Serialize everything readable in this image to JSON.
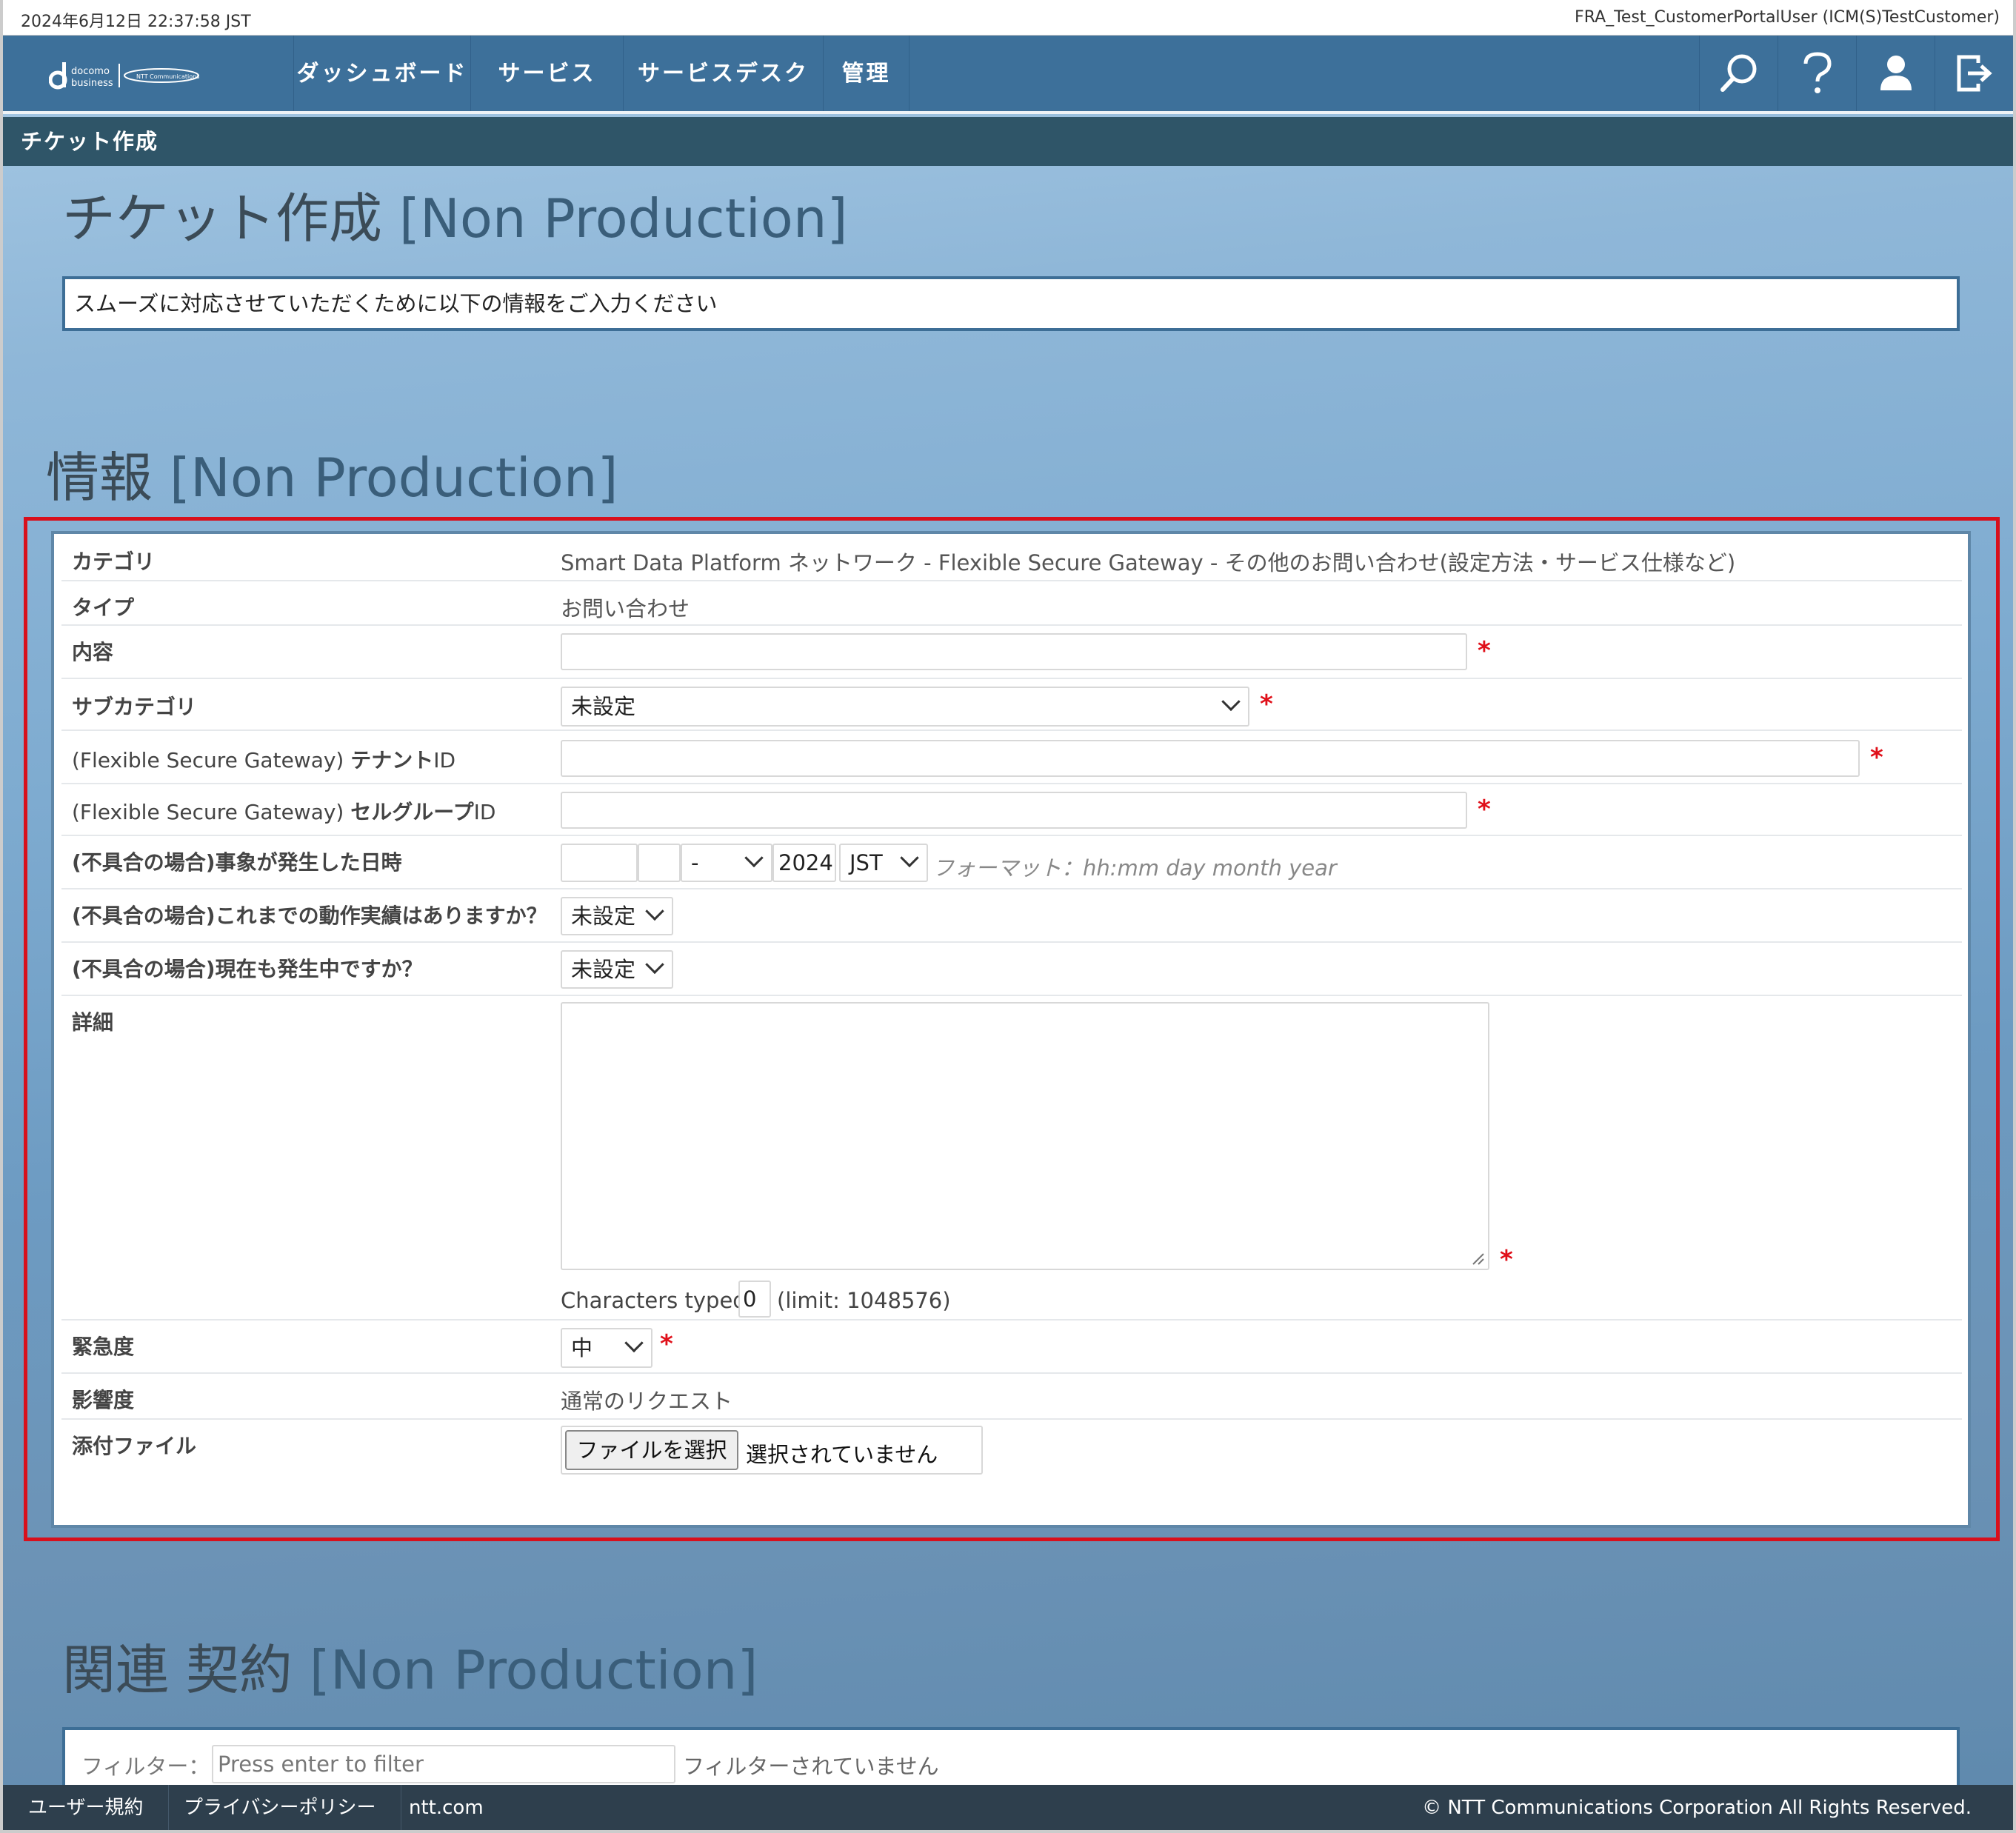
{
  "status_bar": {
    "datetime": "2024年6月12日 22:37:58 JST",
    "user": "FRA_Test_CustomerPortalUser (ICM(S)TestCustomer)"
  },
  "brand": {
    "docomo": "docomo",
    "business": "business",
    "ntt": "NTT Communications"
  },
  "nav": {
    "items": [
      "ダッシュボード",
      "サービス",
      "サービスデスク",
      "管理"
    ],
    "icons": [
      "search-icon",
      "help-icon",
      "user-icon",
      "logout-icon"
    ]
  },
  "breadcrumb": "チケット作成",
  "page": {
    "title": "チケット作成",
    "title_tag": "[Non Production]",
    "notice": "スムーズに対応させていただくために以下の情報をご入力ください"
  },
  "info": {
    "title": "情報",
    "title_tag": "[Non Production]"
  },
  "form": {
    "category_label": "カテゴリ",
    "category_value": "Smart Data Platform ネットワーク - Flexible Secure Gateway - その他のお問い合わせ(設定方法・サービス仕様など)",
    "type_label": "タイプ",
    "type_value": "お問い合わせ",
    "content_label": "内容",
    "subcategory_label": "サブカテゴリ",
    "subcategory_value": "未設定",
    "tenant_label_prefix": "(Flexible Secure Gateway) ",
    "tenant_label": "テナント",
    "tenant_label_suffix": "ID",
    "cellgroup_label_prefix": "(Flexible Secure Gateway) ",
    "cellgroup_label": "セルグループ",
    "cellgroup_label_suffix": "ID",
    "occurred_label": "(不具合の場合)事象が発生した日時",
    "occurred_month": "-",
    "occurred_year": "2024",
    "occurred_tz": "JST",
    "occurred_format": "フォーマット：hh:mm day month year",
    "history_label": "(不具合の場合)これまでの動作実績はありますか？",
    "history_value": "未設定",
    "ongoing_label": "(不具合の場合)現在も発生中ですか？",
    "ongoing_value": "未設定",
    "detail_label": "詳細",
    "chars_typed_label": "Characters typed:",
    "chars_typed_value": "0",
    "chars_limit": "(limit: 1048576)",
    "urgency_label": "緊急度",
    "urgency_value": "中",
    "impact_label": "影響度",
    "impact_value": "通常のリクエスト",
    "attach_label": "添付ファイル",
    "attach_button": "ファイルを選択",
    "attach_status": "選択されていません"
  },
  "contract": {
    "title": "関連 契約",
    "title_tag": "[Non Production]",
    "filter_label": "フィルター：",
    "filter_placeholder": "Press enter to filter",
    "filter_status": "フィルターされていません"
  },
  "footer": {
    "links": [
      "ユーザー規約",
      "プライバシーポリシー",
      "ntt.com"
    ],
    "copyright": "© NTT Communications Corporation All Rights Reserved."
  },
  "colors": {
    "nav": "#3d709a",
    "breadcrumb": "#2f5568",
    "required": "#e0101a",
    "highlight": "#d8101c",
    "footer": "#2e3f4d"
  }
}
